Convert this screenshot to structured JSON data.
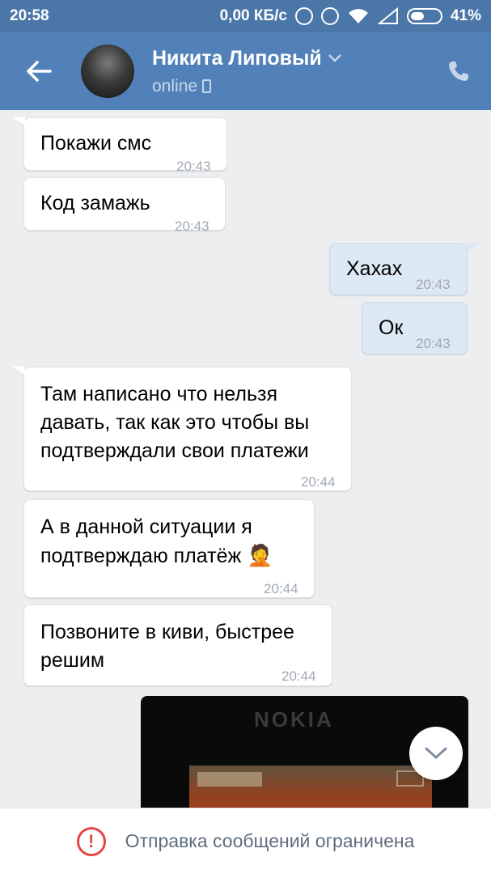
{
  "status_bar": {
    "time": "20:58",
    "speed": "0,00 КБ/с",
    "battery": "41%"
  },
  "header": {
    "back_icon": "arrow-left-icon",
    "name": "Никита Липовый",
    "status": "online",
    "call_icon": "phone-icon"
  },
  "messages": [
    {
      "dir": "in",
      "text": "Покажи смс",
      "time": "20:43"
    },
    {
      "dir": "in",
      "text": "Код замажь",
      "time": "20:43"
    },
    {
      "dir": "out",
      "text": "Хахах",
      "time": "20:43"
    },
    {
      "dir": "out",
      "text": "Ок",
      "time": "20:43"
    },
    {
      "dir": "in",
      "lines": [
        "Там написано что нельзя",
        "давать, так как это чтобы вы",
        "подтверждали свои платежи"
      ],
      "time": "20:44"
    },
    {
      "dir": "in",
      "lines": [
        "А в данной ситуации я",
        "подтверждаю платёж"
      ],
      "emoji": "🤦",
      "time": "20:44"
    },
    {
      "dir": "in",
      "lines": [
        "Позвоните в киви, быстрее",
        "решим"
      ],
      "time": "20:44"
    }
  ],
  "photo": {
    "caption_text": "NOKIA"
  },
  "footer": {
    "warning_icon": "exclamation-icon",
    "text": "Отправка сообщений ограничена"
  },
  "colors": {
    "header": "#5181b8",
    "status_bar": "#4a76a8",
    "chat_bg": "#edeef0",
    "out_bubble": "#dde8f5",
    "warning": "#e64646"
  }
}
